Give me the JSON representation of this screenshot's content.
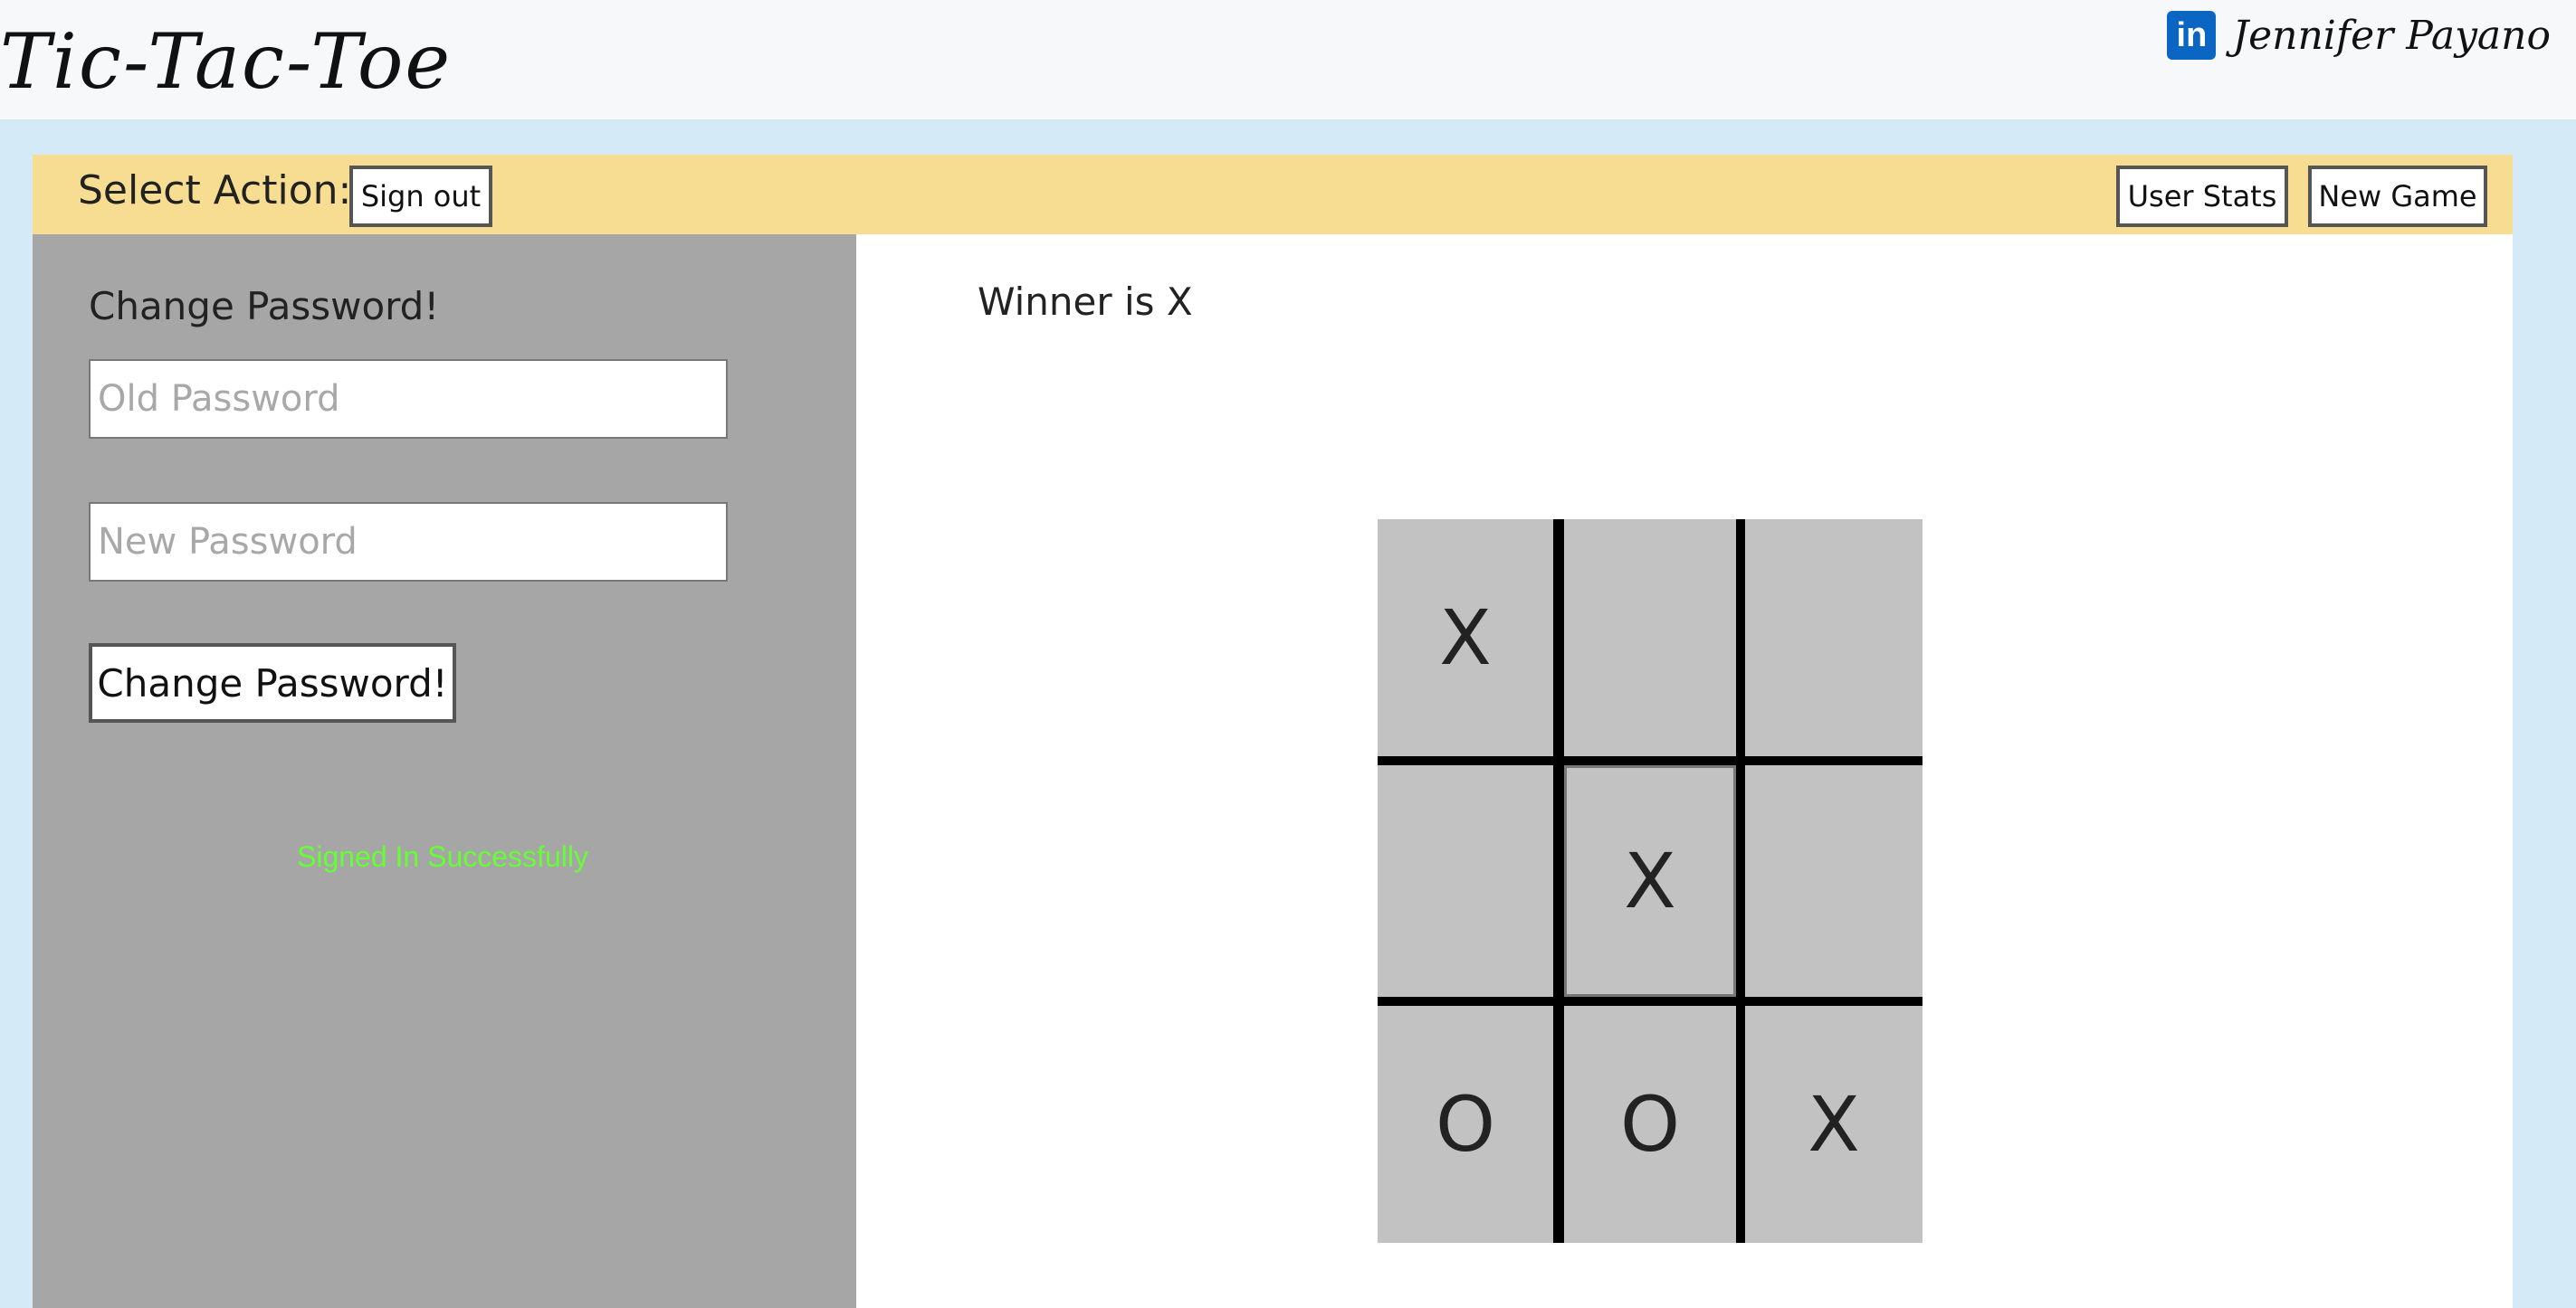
{
  "header": {
    "title": "Tic-Tac-Toe",
    "linkedin_icon": "in",
    "author": "Jennifer Payano"
  },
  "action_bar": {
    "label": "Select Action:",
    "sign_out": "Sign out",
    "user_stats": "User Stats",
    "new_game": "New Game"
  },
  "sidebar": {
    "heading": "Change Password!",
    "old_password_placeholder": "Old Password",
    "new_password_placeholder": "New Password",
    "submit_label": "Change Password!",
    "status_message": "Signed In Successfully",
    "status_color": "#66ff33"
  },
  "game": {
    "status": "Winner is X",
    "board": [
      "X",
      "",
      "",
      "",
      "X",
      "",
      "O",
      "O",
      "X"
    ]
  },
  "colors": {
    "page_background": "#d4eaf7",
    "action_bar": "#f6dd92",
    "sidebar": "#a6a6a6",
    "cell": "#c2c2c2"
  }
}
